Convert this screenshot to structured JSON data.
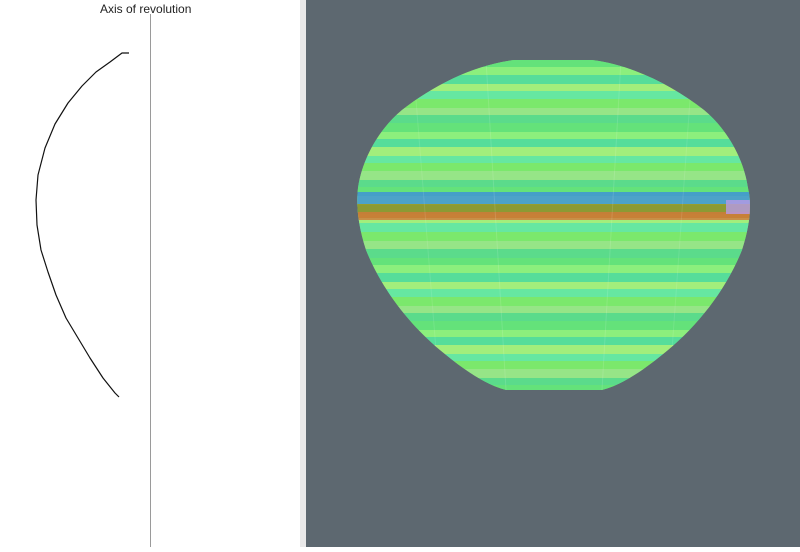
{
  "editor": {
    "axis_label": "Axis of revolution"
  },
  "viewport": {
    "background": "#5d6870",
    "mesh_base_color": "#7de87a"
  }
}
